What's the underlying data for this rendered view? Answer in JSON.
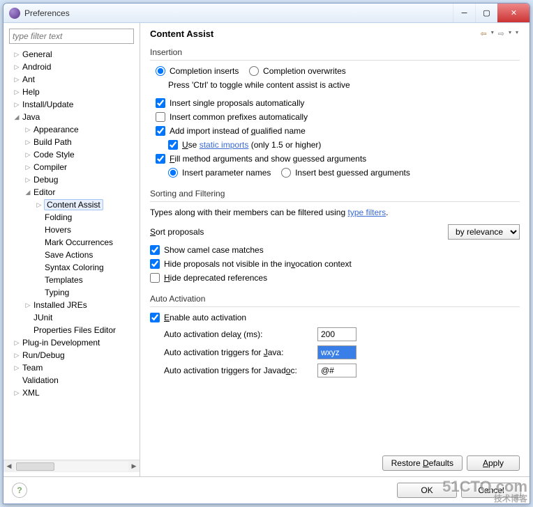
{
  "window": {
    "title": "Preferences"
  },
  "filter": {
    "placeholder": "type filter text"
  },
  "tree": {
    "general": "General",
    "android": "Android",
    "ant": "Ant",
    "help": "Help",
    "install": "Install/Update",
    "java": "Java",
    "appearance": "Appearance",
    "buildpath": "Build Path",
    "codestyle": "Code Style",
    "compiler": "Compiler",
    "debug": "Debug",
    "editor": "Editor",
    "contentassist": "Content Assist",
    "folding": "Folding",
    "hovers": "Hovers",
    "mark": "Mark Occurrences",
    "save": "Save Actions",
    "syntax": "Syntax Coloring",
    "templates": "Templates",
    "typing": "Typing",
    "jres": "Installed JREs",
    "junit": "JUnit",
    "propfiles": "Properties Files Editor",
    "plugin": "Plug-in Development",
    "rundebug": "Run/Debug",
    "team": "Team",
    "validation": "Validation",
    "xml": "XML"
  },
  "page": {
    "title": "Content Assist",
    "insertion": {
      "label": "Insertion",
      "r1": "Completion inserts",
      "r2": "Completion overwrites",
      "hint": "Press 'Ctrl' to toggle while content assist is active",
      "c1": "Insert single proposals automatically",
      "c2": "Insert common prefixes automatically",
      "c3_pre": "Add import instead of ",
      "c3_u": "q",
      "c3_post": "ualified name",
      "c4_pre": "U",
      "c4_post": "se ",
      "c4_link": "static imports",
      "c4_tail": " (only 1.5 or higher)",
      "c5_pre": "F",
      "c5_post": "ill method arguments and show guessed arguments",
      "r3": "Insert parameter names",
      "r4": "Insert best guessed arguments"
    },
    "sorting": {
      "label": "Sorting and Filtering",
      "intro_a": "Types along with their members can be filtered using ",
      "intro_link": "type filters",
      "intro_b": ".",
      "sort_pre": "S",
      "sort_post": "ort proposals",
      "select": "by relevance",
      "c1": "Show camel case matches",
      "c2_pre": "Hide proposals not visible in the in",
      "c2_u": "v",
      "c2_post": "ocation context",
      "c3_pre": "H",
      "c3_post": "ide deprecated references"
    },
    "auto": {
      "label": "Auto Activation",
      "c1_pre": "E",
      "c1_post": "nable auto activation",
      "delay_pre": "Auto activation dela",
      "delay_u": "y",
      "delay_post": " (ms):",
      "delay_val": "200",
      "trig_j_pre": "Auto activation triggers for ",
      "trig_j_u": "J",
      "trig_j_post": "ava:",
      "trig_j_val": "wxyz",
      "trig_d_pre": "Auto activation triggers for Javad",
      "trig_d_u": "o",
      "trig_d_post": "c:",
      "trig_d_val": "@#"
    },
    "restore_pre": "Restore ",
    "restore_u": "D",
    "restore_post": "efaults",
    "apply_pre": "A",
    "apply_post": "pply",
    "ok": "OK",
    "cancel": "Cancel"
  },
  "watermark": {
    "line1": "51CTO.com",
    "line2": "技术博客"
  }
}
